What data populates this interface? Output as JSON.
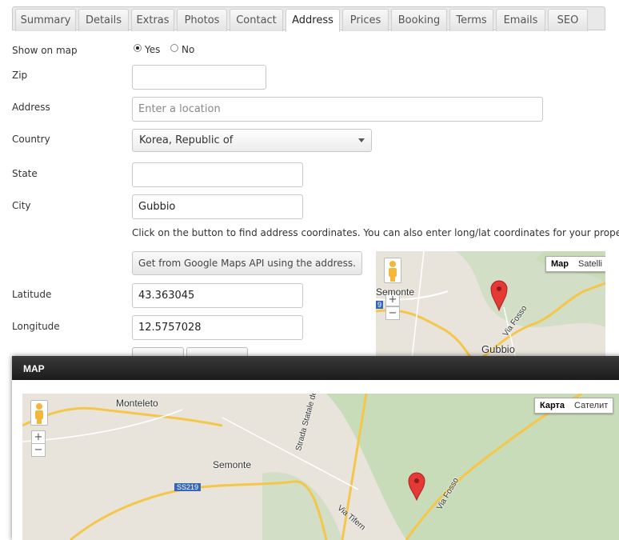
{
  "tabs": [
    {
      "label": "Summary",
      "active": false
    },
    {
      "label": "Details",
      "active": false
    },
    {
      "label": "Extras",
      "active": false
    },
    {
      "label": "Photos",
      "active": false
    },
    {
      "label": "Contact",
      "active": false
    },
    {
      "label": "Address",
      "active": true
    },
    {
      "label": "Prices",
      "active": false
    },
    {
      "label": "Booking",
      "active": false
    },
    {
      "label": "Terms",
      "active": false
    },
    {
      "label": "Emails",
      "active": false
    },
    {
      "label": "SEO",
      "active": false
    }
  ],
  "form": {
    "show_on_map": {
      "label": "Show on map",
      "options": [
        "Yes",
        "No"
      ],
      "selected": "Yes"
    },
    "zip": {
      "label": "Zip",
      "value": ""
    },
    "address": {
      "label": "Address",
      "value": "",
      "placeholder": "Enter a location"
    },
    "country": {
      "label": "Country",
      "value": "Korea, Republic of"
    },
    "state": {
      "label": "State",
      "value": ""
    },
    "city": {
      "label": "City",
      "value": "Gubbio"
    },
    "hint": "Click on the button to find address coordinates. You can also enter long/lat coordinates for your property.",
    "geocode_button": "Get from Google Maps API using the address.",
    "latitude": {
      "label": "Latitude",
      "value": "43.363045"
    },
    "longitude": {
      "label": "Longitude",
      "value": "12.5757028"
    }
  },
  "small_map": {
    "map_type": [
      "Map",
      "Satelli"
    ],
    "zoom_in": "+",
    "zoom_out": "−",
    "labels": {
      "semonte": "Semonte",
      "gubbio": "Gubbio",
      "via_fosso": "Via Fosso",
      "road_num": "9"
    }
  },
  "modal": {
    "title": "MAP",
    "map_type": [
      "Карта",
      "Сателит"
    ],
    "zoom_in": "+",
    "zoom_out": "−",
    "labels": {
      "monteleto": "Monteleto",
      "semonte": "Semonte",
      "ss219": "SS219",
      "strada": "Strada Statale della Contessa",
      "via_fosso": "Via Fosso",
      "via_tifern": "Via Tifern"
    }
  },
  "colors": {
    "road": "#f4c64a",
    "terrain": "#e8e4dc",
    "forest": "#c9dcb9",
    "pin": "#e53935"
  }
}
